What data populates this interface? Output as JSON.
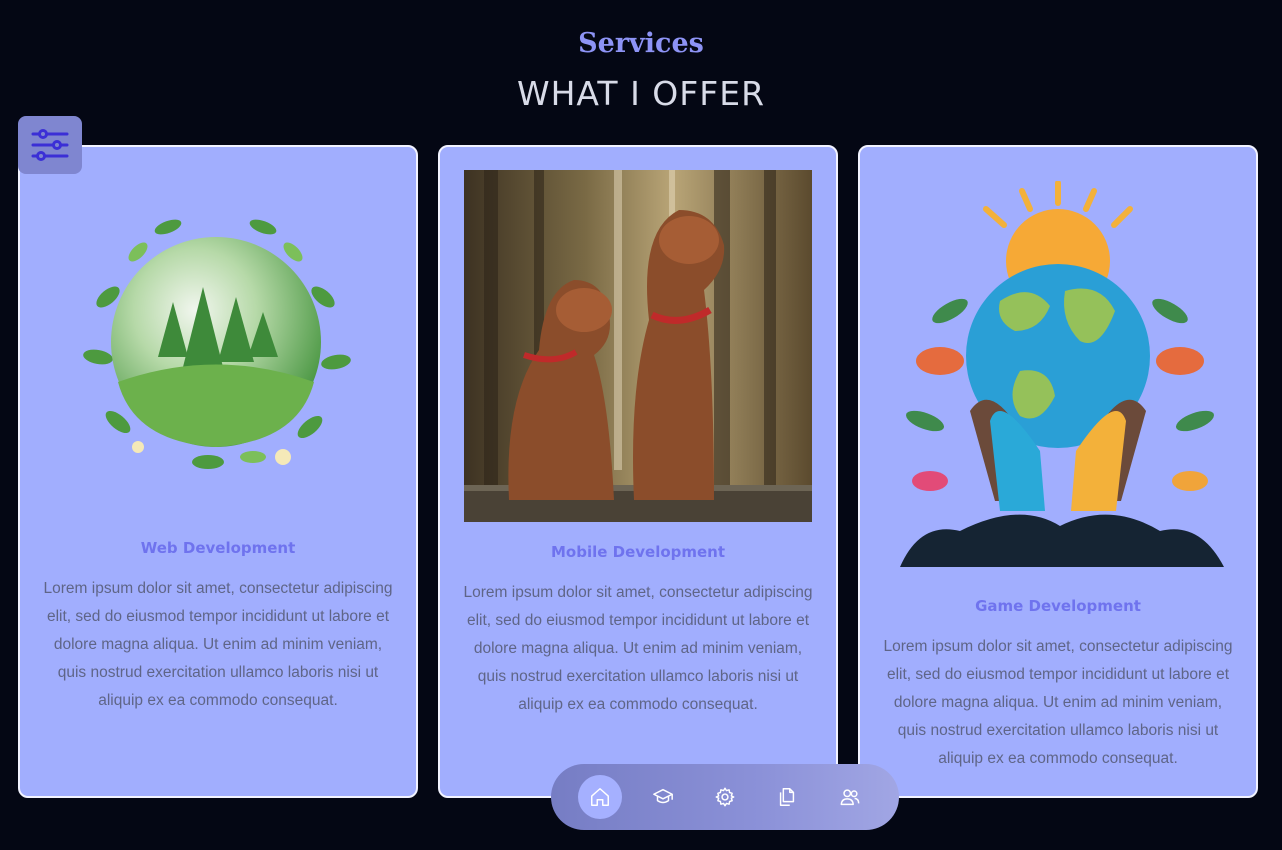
{
  "header": {
    "subtitle": "Services",
    "title": "WHAT I OFFER"
  },
  "filter_button": {
    "icon": "sliders-icon"
  },
  "cards": [
    {
      "title": "Web Development",
      "image": "eco-globe-forest-illustration",
      "text": "Lorem ipsum dolor sit amet, consectetur adipiscing elit, sed do eiusmod tempor incididunt ut labore et dolore magna aliqua. Ut enim ad minim veniam, quis nostrud exercitation ullamco laboris nisi ut aliquip ex ea commodo consequat."
    },
    {
      "title": "Mobile Development",
      "image": "two-brown-dogs-photo",
      "text": "Lorem ipsum dolor sit amet, consectetur adipiscing elit, sed do eiusmod tempor incididunt ut labore et dolore magna aliqua. Ut enim ad minim veniam, quis nostrud exercitation ullamco laboris nisi ut aliquip ex ea commodo consequat."
    },
    {
      "title": "Game Development",
      "image": "hands-holding-earth-illustration",
      "text": "Lorem ipsum dolor sit amet, consectetur adipiscing elit, sed do eiusmod tempor incididunt ut labore et dolore magna aliqua. Ut enim ad minim veniam, quis nostrud exercitation ullamco laboris nisi ut aliquip ex ea commodo consequat."
    }
  ],
  "nav": {
    "items": [
      {
        "icon": "home-icon",
        "active": true
      },
      {
        "icon": "graduation-cap-icon",
        "active": false
      },
      {
        "icon": "gear-icon",
        "active": false
      },
      {
        "icon": "documents-icon",
        "active": false
      },
      {
        "icon": "users-icon",
        "active": false
      }
    ]
  },
  "colors": {
    "background": "#040714",
    "card": "#a1aefe",
    "accent": "#8d93f5",
    "card_title": "#6f73ee"
  }
}
